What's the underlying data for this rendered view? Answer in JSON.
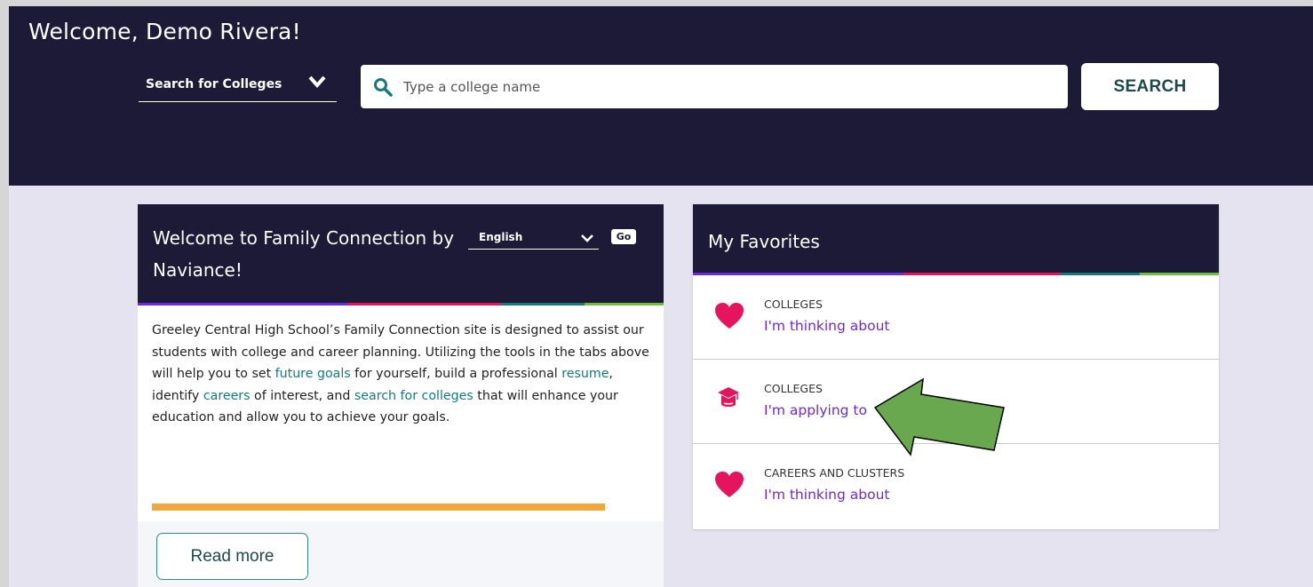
{
  "header": {
    "welcome": "Welcome, Demo Rivera!",
    "search_type": "Search for Colleges",
    "search_placeholder": "Type a college name",
    "search_button": "SEARCH"
  },
  "welcome_card": {
    "title": "Welcome to Family Connection by Naviance!",
    "language": "English",
    "go_label": "Go",
    "body": [
      {
        "t": "Greeley Central High School’s Family Connection site is designed to assist our students with college and career planning. Utilizing the tools in the tabs above will help you to set ",
        "link": false
      },
      {
        "t": "future goals",
        "link": true
      },
      {
        "t": " for yourself, build a professional ",
        "link": false
      },
      {
        "t": "resume",
        "link": true
      },
      {
        "t": ", identify ",
        "link": false
      },
      {
        "t": "careers",
        "link": true
      },
      {
        "t": " of interest, and ",
        "link": false
      },
      {
        "t": "search for colleges",
        "link": true
      },
      {
        "t": " that will enhance your education and allow you to achieve your goals.",
        "link": false
      }
    ],
    "read_more": "Read more"
  },
  "favorites": {
    "title": "My Favorites",
    "items": [
      {
        "category": "COLLEGES",
        "label": "I'm thinking about",
        "icon": "heart-icon"
      },
      {
        "category": "COLLEGES",
        "label": "I'm applying to",
        "icon": "graduation-cap-icon"
      },
      {
        "category": "CAREERS AND CLUSTERS",
        "label": "I'm thinking about",
        "icon": "heart-icon"
      }
    ]
  },
  "colors": {
    "navy": "#1c1a37",
    "teal_link": "#157a7a",
    "purple_link": "#6a2bd9",
    "heart": "#e5145d",
    "arrow_green": "#6aa84f",
    "accent_bar": [
      "#6a2bd9",
      "#e5145d",
      "#157a7a",
      "#6fbf3f"
    ]
  }
}
